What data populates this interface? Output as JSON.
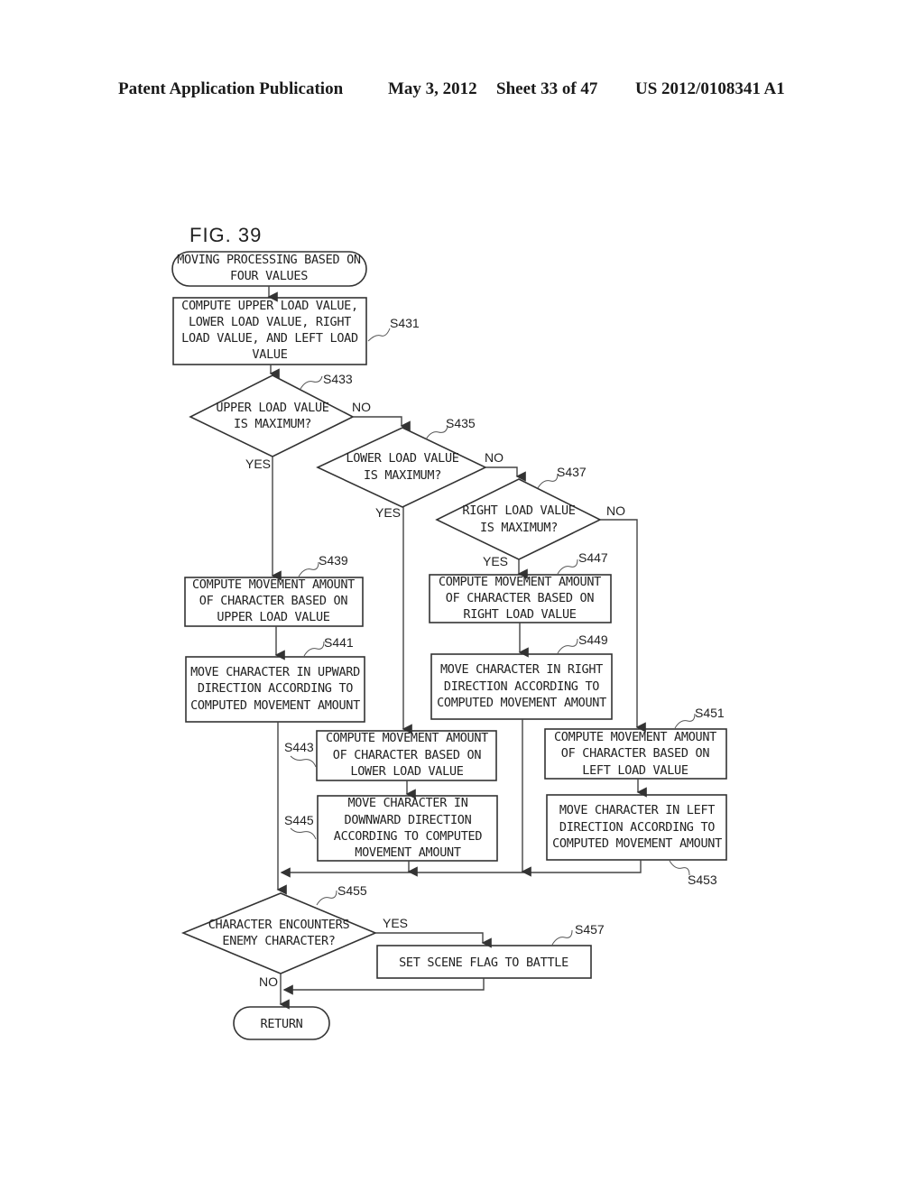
{
  "header": {
    "publication": "Patent Application Publication",
    "date": "May 3, 2012",
    "sheet": "Sheet 33 of 47",
    "number": "US 2012/0108341 A1"
  },
  "figure": {
    "label": "FIG. 39",
    "start": [
      "MOVING PROCESSING BASED ON",
      "FOUR VALUES"
    ],
    "end": [
      "RETURN"
    ],
    "steps": {
      "s431": {
        "id": "S431",
        "lines": [
          "COMPUTE UPPER LOAD VALUE,",
          "LOWER LOAD VALUE, RIGHT",
          "LOAD VALUE, AND LEFT LOAD",
          "VALUE"
        ]
      },
      "s433": {
        "id": "S433",
        "lines": [
          "UPPER LOAD VALUE",
          "IS MAXIMUM?"
        ]
      },
      "s435": {
        "id": "S435",
        "lines": [
          "LOWER LOAD VALUE",
          "IS MAXIMUM?"
        ]
      },
      "s437": {
        "id": "S437",
        "lines": [
          "RIGHT LOAD VALUE",
          "IS MAXIMUM?"
        ]
      },
      "s439": {
        "id": "S439",
        "lines": [
          "COMPUTE MOVEMENT AMOUNT",
          "OF CHARACTER BASED ON",
          "UPPER LOAD VALUE"
        ]
      },
      "s441": {
        "id": "S441",
        "lines": [
          "MOVE CHARACTER IN UPWARD",
          "DIRECTION ACCORDING TO",
          "COMPUTED MOVEMENT AMOUNT"
        ]
      },
      "s443": {
        "id": "S443",
        "lines": [
          "COMPUTE MOVEMENT AMOUNT",
          "OF CHARACTER BASED ON",
          "LOWER LOAD VALUE"
        ]
      },
      "s445": {
        "id": "S445",
        "lines": [
          "MOVE CHARACTER IN",
          "DOWNWARD DIRECTION",
          "ACCORDING TO COMPUTED",
          "MOVEMENT AMOUNT"
        ]
      },
      "s447": {
        "id": "S447",
        "lines": [
          "COMPUTE MOVEMENT AMOUNT",
          "OF CHARACTER BASED ON",
          "RIGHT LOAD VALUE"
        ]
      },
      "s449": {
        "id": "S449",
        "lines": [
          "MOVE CHARACTER IN RIGHT",
          "DIRECTION ACCORDING TO",
          "COMPUTED MOVEMENT AMOUNT"
        ]
      },
      "s451": {
        "id": "S451",
        "lines": [
          "COMPUTE MOVEMENT AMOUNT",
          "OF CHARACTER BASED ON",
          "LEFT LOAD VALUE"
        ]
      },
      "s453": {
        "id": "S453",
        "lines": [
          "MOVE CHARACTER IN LEFT",
          "DIRECTION ACCORDING TO",
          "COMPUTED MOVEMENT AMOUNT"
        ]
      },
      "s455": {
        "id": "S455",
        "lines": [
          "CHARACTER ENCOUNTERS",
          "ENEMY CHARACTER?"
        ]
      },
      "s457": {
        "id": "S457",
        "lines": [
          "SET SCENE FLAG TO BATTLE"
        ]
      }
    },
    "branch_labels": {
      "yes": "YES",
      "no": "NO"
    }
  }
}
